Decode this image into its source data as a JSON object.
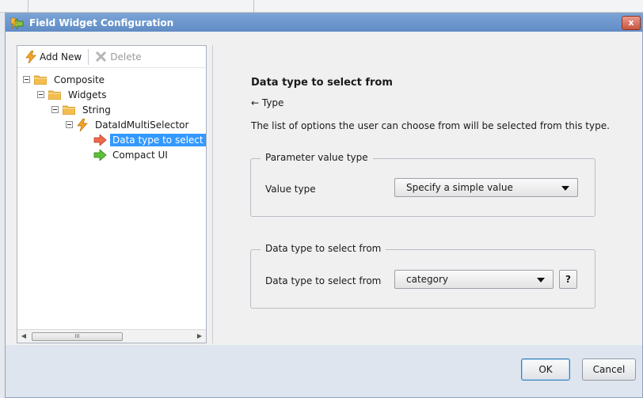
{
  "window": {
    "title": "Field Widget Configuration",
    "close_label": "x"
  },
  "toolbar": {
    "add_new": "Add New",
    "delete": "Delete"
  },
  "tree": [
    {
      "label": "Composite",
      "icon": "folder-icon",
      "expander": true
    },
    {
      "label": "Widgets",
      "icon": "folder-icon",
      "expander": true
    },
    {
      "label": "String",
      "icon": "folder-icon",
      "expander": true
    },
    {
      "label": "DataIdMultiSelector",
      "icon": "lightning-icon",
      "expander": true
    },
    {
      "label": "Data type to select",
      "icon": "arrow-right-red-icon",
      "selected": true
    },
    {
      "label": "Compact UI",
      "icon": "arrow-right-green-icon"
    }
  ],
  "scrollbar": {
    "thumb_grip": "III"
  },
  "detail": {
    "title": "Data type to select from",
    "back": "← Type",
    "description": "The list of options the user can choose from will be selected from this type."
  },
  "param_group": {
    "legend": "Parameter value type",
    "field_label": "Value type",
    "selected": "Specify a simple value"
  },
  "datatype_group": {
    "legend": "Data type to select from",
    "field_label": "Data type to select from",
    "selected": "category",
    "help": "?"
  },
  "footer": {
    "ok": "OK",
    "cancel": "Cancel"
  },
  "colors": {
    "titlebar": "#6f98cf",
    "selection": "#3399ff",
    "folder": "#f0b43c"
  }
}
